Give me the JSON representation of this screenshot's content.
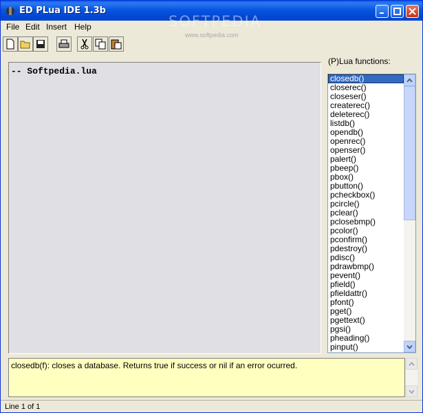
{
  "window": {
    "title": "ED PLua IDE 1.3b",
    "watermark": "SOFTPEDIA",
    "watermark_url": "www.softpedia.com",
    "controls": [
      "minimize-icon",
      "maximize-icon",
      "close-icon"
    ]
  },
  "menu": {
    "items": [
      {
        "label": "File"
      },
      {
        "label": "Edit"
      },
      {
        "label": "Insert"
      },
      {
        "label": "Help"
      }
    ]
  },
  "toolbar": {
    "buttons": [
      "new-file-icon",
      "open-folder-icon",
      "save-icon",
      "print-icon",
      "cut-icon",
      "copy-icon",
      "paste-icon"
    ]
  },
  "editor": {
    "content": "-- Softpedia.lua"
  },
  "functions": {
    "label": "(P)Lua functions:",
    "items": [
      "closedb()",
      "closerec()",
      "closeser()",
      "createrec()",
      "deleterec()",
      "listdb()",
      "opendb()",
      "openrec()",
      "openser()",
      "palert()",
      "pbeep()",
      "pbox()",
      "pbutton()",
      "pcheckbox()",
      "pcircle()",
      "pclear()",
      "pclosebmp()",
      "pcolor()",
      "pconfirm()",
      "pdestroy()",
      "pdisc()",
      "pdrawbmp()",
      "pevent()",
      "pfield()",
      "pfieldattr()",
      "pfont()",
      "pget()",
      "pgettext()",
      "pgsi()",
      "pheading()",
      "pinput()"
    ],
    "selected_index": 0
  },
  "description": {
    "text": "closedb(f): closes a database. Returns true if success or nil if an error ocurred."
  },
  "status": {
    "text": "Line 1 of 1"
  },
  "colors": {
    "titlebar": "#0a5de8",
    "selection": "#316ac5",
    "description_bg": "#ffffc0",
    "editor_bg": "#e0dfe3"
  }
}
